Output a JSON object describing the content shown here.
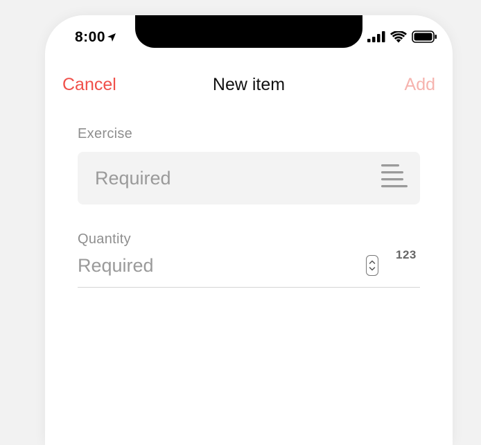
{
  "status_bar": {
    "time": "8:00",
    "icons": [
      "location-arrow-icon",
      "cellular-signal-icon",
      "wifi-icon",
      "battery-icon"
    ]
  },
  "nav": {
    "cancel_label": "Cancel",
    "title": "New item",
    "add_label": "Add"
  },
  "form": {
    "exercise": {
      "label": "Exercise",
      "placeholder": "Required",
      "icon": "list-icon"
    },
    "quantity": {
      "label": "Quantity",
      "placeholder": "Required",
      "keyboard_hint": "123",
      "icon": "stepper-icon"
    }
  },
  "colors": {
    "accent": "#f0504a",
    "accent_disabled": "#f6b3ae",
    "field_bg": "#f3f3f3",
    "placeholder": "#9a9a9a",
    "label": "#8e8e8e"
  }
}
